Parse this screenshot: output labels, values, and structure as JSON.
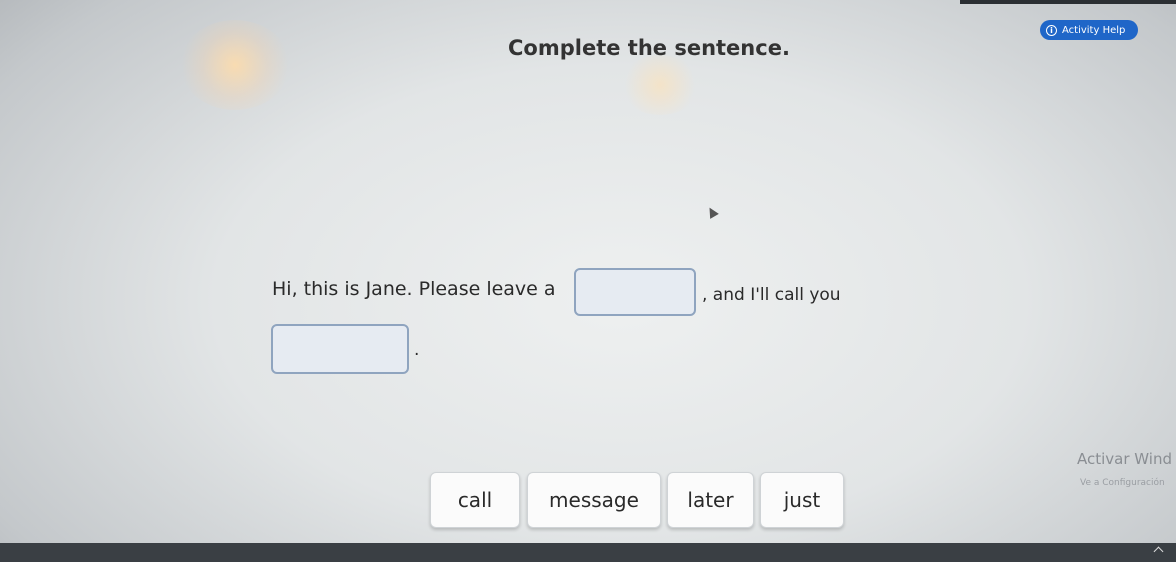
{
  "header": {
    "help_label": "Activity Help",
    "help_icon": "info-icon"
  },
  "instruction": "Complete the sentence.",
  "sentence": {
    "part1": "Hi, this is Jane. Please leave a",
    "part2": ", and I'll call you",
    "part3": "."
  },
  "blanks": [
    {
      "value": ""
    },
    {
      "value": ""
    }
  ],
  "word_bank": [
    "call",
    "message",
    "later",
    "just"
  ],
  "watermark": {
    "line1": "Activar Wind",
    "line2": "Ve a Configuración"
  },
  "colors": {
    "accent": "#1f66c8",
    "blank_border": "#8fa4bf"
  }
}
